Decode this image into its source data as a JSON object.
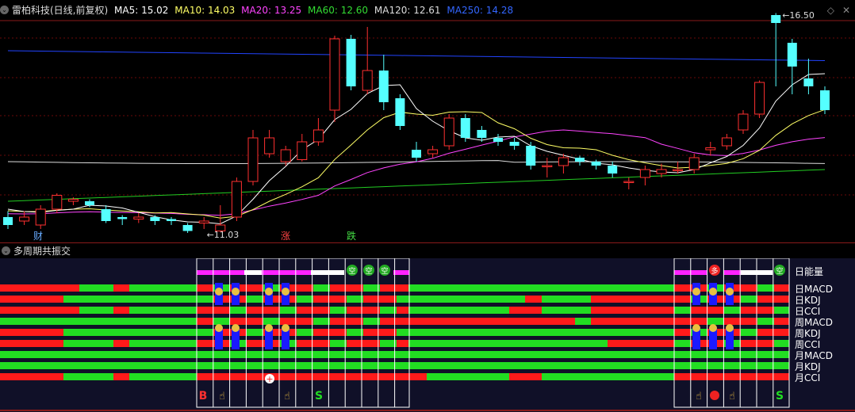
{
  "header": {
    "stock_title": "雷柏科技(日线,前复权)",
    "indicators": [
      {
        "label": "MA5: 15.02",
        "color": "#ffffff"
      },
      {
        "label": "MA10: 14.03",
        "color": "#ffff66"
      },
      {
        "label": "MA20: 13.25",
        "color": "#ff44ff"
      },
      {
        "label": "MA60: 12.60",
        "color": "#33dd33"
      },
      {
        "label": "MA120: 12.61",
        "color": "#dddddd"
      },
      {
        "label": "MA250: 14.28",
        "color": "#3366ff"
      }
    ]
  },
  "main_chart": {
    "high_label": "16.50",
    "low_label": "11.03",
    "markers": [
      {
        "label": "财",
        "color": "#66aaff"
      },
      {
        "label": "涨",
        "color": "#ff4444"
      },
      {
        "label": "跌",
        "color": "#44dd44"
      }
    ],
    "candles": [
      [
        11.4,
        11.2,
        11.55,
        11.1
      ],
      [
        11.3,
        11.4,
        11.55,
        11.2
      ],
      [
        11.2,
        11.6,
        11.7,
        11.1
      ],
      [
        11.6,
        11.95,
        12.0,
        11.5
      ],
      [
        11.8,
        11.85,
        11.9,
        11.7
      ],
      [
        11.8,
        11.7,
        11.85,
        11.65
      ],
      [
        11.6,
        11.3,
        11.7,
        11.25
      ],
      [
        11.4,
        11.35,
        11.45,
        11.2
      ],
      [
        11.35,
        11.4,
        11.5,
        11.25
      ],
      [
        11.4,
        11.3,
        11.45,
        11.2
      ],
      [
        11.35,
        11.3,
        11.4,
        11.2
      ],
      [
        11.2,
        11.05,
        11.25,
        11.0
      ],
      [
        11.25,
        11.3,
        11.4,
        11.1
      ],
      [
        11.05,
        11.2,
        11.7,
        11.03
      ],
      [
        11.4,
        12.3,
        12.4,
        11.3
      ],
      [
        12.3,
        13.4,
        13.6,
        12.2
      ],
      [
        13.0,
        13.4,
        13.6,
        12.9
      ],
      [
        12.8,
        13.1,
        13.2,
        12.7
      ],
      [
        12.85,
        13.3,
        13.5,
        12.8
      ],
      [
        13.3,
        13.6,
        13.9,
        13.2
      ],
      [
        14.1,
        15.9,
        15.98,
        13.8
      ],
      [
        15.9,
        14.7,
        16.0,
        14.6
      ],
      [
        14.6,
        15.1,
        16.2,
        14.5
      ],
      [
        15.1,
        14.3,
        15.5,
        14.1
      ],
      [
        14.4,
        13.7,
        14.5,
        13.6
      ],
      [
        13.1,
        12.9,
        13.3,
        12.8
      ],
      [
        13.0,
        13.1,
        13.2,
        12.9
      ],
      [
        13.2,
        13.9,
        14.0,
        13.1
      ],
      [
        13.9,
        13.4,
        14.0,
        13.3
      ],
      [
        13.6,
        13.4,
        13.7,
        13.3
      ],
      [
        13.4,
        13.3,
        13.5,
        13.2
      ],
      [
        13.3,
        13.2,
        13.4,
        13.1
      ],
      [
        13.2,
        12.7,
        13.3,
        12.6
      ],
      [
        12.7,
        12.7,
        12.9,
        12.4
      ],
      [
        12.7,
        12.9,
        13.0,
        12.5
      ],
      [
        12.9,
        12.8,
        12.95,
        12.7
      ],
      [
        12.8,
        12.7,
        12.85,
        12.6
      ],
      [
        12.7,
        12.5,
        12.8,
        12.4
      ],
      [
        12.3,
        12.3,
        12.4,
        12.1
      ],
      [
        12.4,
        12.6,
        12.7,
        12.2
      ],
      [
        12.5,
        12.6,
        12.75,
        12.4
      ],
      [
        12.6,
        12.6,
        12.8,
        12.5
      ],
      [
        12.6,
        12.9,
        13.0,
        12.5
      ],
      [
        13.1,
        13.15,
        13.3,
        12.95
      ],
      [
        13.2,
        13.4,
        13.5,
        13.1
      ],
      [
        13.6,
        14.0,
        14.1,
        13.5
      ],
      [
        14.0,
        14.8,
        14.85,
        13.9
      ],
      [
        16.5,
        16.3,
        16.55,
        14.7
      ],
      [
        15.8,
        15.2,
        15.9,
        14.5
      ],
      [
        14.9,
        14.7,
        15.4,
        14.5
      ],
      [
        14.6,
        14.1,
        14.7,
        14.0
      ]
    ]
  },
  "panel": {
    "title": "多周期共振交",
    "rows": [
      "日能量",
      "日MACD",
      "日KDJ",
      "日CCI",
      "周MACD",
      "周KDJ",
      "周CCI",
      "月MACD",
      "月KDJ",
      "月CCI"
    ],
    "energy_badges": [
      "空",
      "空",
      "空",
      "多",
      "空"
    ],
    "bottom_signals": [
      "B",
      "S",
      "S"
    ],
    "colors": {
      "red": "#ff1a1a",
      "green": "#22dd22",
      "magenta": "#ff22ff",
      "blue": "#1a1aff",
      "white": "#ffffff"
    }
  }
}
